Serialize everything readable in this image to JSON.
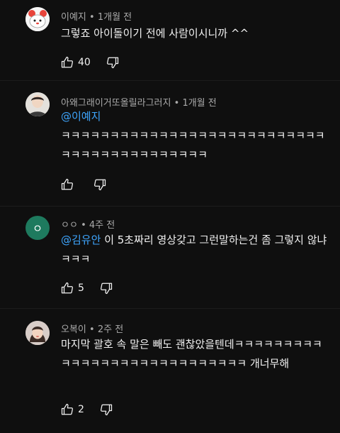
{
  "comments": [
    {
      "author": "이예지",
      "time": "1개월 전",
      "mention": "",
      "body": "그렇죠 아이돌이기 전에 사람이시니까 ^^",
      "likes": "40",
      "avatar_icon": "sanrio-character-avatar"
    },
    {
      "author": "아왜그래이거또올릴라그러지",
      "time": "1개월 전",
      "mention": "@이예지",
      "body": "ㅋㅋㅋㅋㅋㅋㅋㅋㅋㅋㅋㅋㅋㅋㅋㅋㅋㅋㅋㅋㅋㅋㅋㅋㅋㅋㅋㅋㅋㅋㅋㅋㅋㅋㅋㅋㅋㅋㅋㅋㅋㅋ",
      "likes": "",
      "avatar_icon": "person-photo-avatar"
    },
    {
      "author": "ㅇㅇ",
      "time": "4주 전",
      "mention": "@김유안",
      "body": "이 5초짜리 영상갖고 그런말하는건 좀 그렇지 않냐ㅋㅋㅋ",
      "likes": "5",
      "avatar_letter": "ㅇ",
      "avatar_color": "#1e7a5e"
    },
    {
      "author": "오복이",
      "time": "2주 전",
      "mention": "",
      "body": "마지막 괄호 속 말은 빼도 괜찮았을텐데ㅋㅋㅋㅋㅋㅋㅋㅋㅋㅋㅋㅋㅋㅋㅋㅋㅋㅋㅋㅋㅋㅋㅋㅋㅋㅋㅋㅋ 개너무해",
      "likes": "2",
      "avatar_icon": "woman-photo-avatar"
    }
  ],
  "meta_separator": "•"
}
